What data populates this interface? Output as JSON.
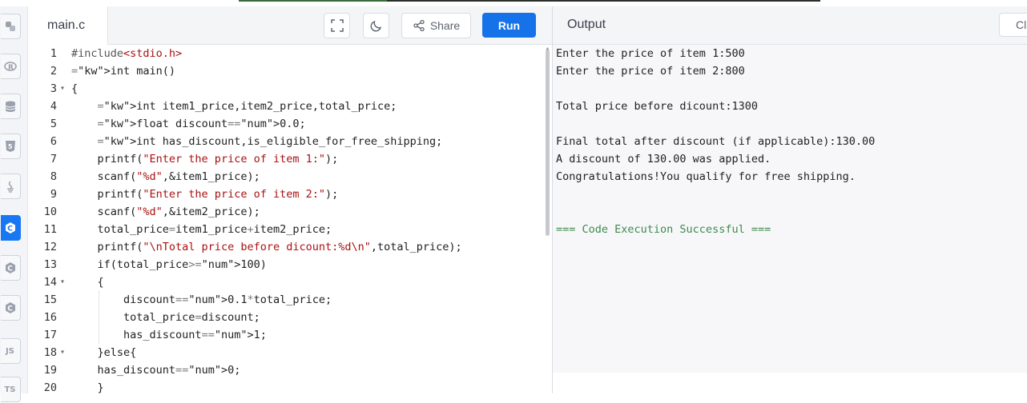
{
  "rail": {
    "items": [
      {
        "name": "python-icon",
        "active": false
      },
      {
        "name": "r-icon",
        "active": false
      },
      {
        "name": "sql-icon",
        "active": false
      },
      {
        "name": "html5-icon",
        "active": false
      },
      {
        "name": "java-icon",
        "active": false
      },
      {
        "name": "c-icon",
        "active": true
      },
      {
        "name": "cpp-icon",
        "active": false
      },
      {
        "name": "csharp-icon",
        "active": false
      },
      {
        "name": "js-icon",
        "label": "JS",
        "active": false
      },
      {
        "name": "ts-icon",
        "label": "TS",
        "active": false
      }
    ]
  },
  "editor": {
    "file_name": "main.c",
    "share_label": "Share",
    "run_label": "Run",
    "lines": [
      {
        "n": "1",
        "fold": "",
        "text": "#include<stdio.h>"
      },
      {
        "n": "2",
        "fold": "",
        "text": "int main()"
      },
      {
        "n": "3",
        "fold": "▾",
        "text": "{"
      },
      {
        "n": "4",
        "fold": "",
        "text": "    int item1_price,item2_price,total_price;"
      },
      {
        "n": "5",
        "fold": "",
        "text": "    float discount=0.0;"
      },
      {
        "n": "6",
        "fold": "",
        "text": "    int has_discount,is_eligible_for_free_shipping;"
      },
      {
        "n": "7",
        "fold": "",
        "text": "    printf(\"Enter the price of item 1:\");"
      },
      {
        "n": "8",
        "fold": "",
        "text": "    scanf(\"%d\",&item1_price);"
      },
      {
        "n": "9",
        "fold": "",
        "text": "    printf(\"Enter the price of item 2:\");"
      },
      {
        "n": "10",
        "fold": "",
        "text": "    scanf(\"%d\",&item2_price);"
      },
      {
        "n": "11",
        "fold": "",
        "text": "    total_price=item1_price+item2_price;"
      },
      {
        "n": "12",
        "fold": "",
        "text": "    printf(\"\\nTotal price before dicount:%d\\n\",total_price);"
      },
      {
        "n": "13",
        "fold": "",
        "text": "    if(total_price>100)"
      },
      {
        "n": "14",
        "fold": "▾",
        "text": "    {"
      },
      {
        "n": "15",
        "fold": "",
        "text": "        discount=0.1*total_price;"
      },
      {
        "n": "16",
        "fold": "",
        "text": "        total_price=discount;"
      },
      {
        "n": "17",
        "fold": "",
        "text": "        has_discount=1;"
      },
      {
        "n": "18",
        "fold": "▾",
        "text": "    }else{"
      },
      {
        "n": "19",
        "fold": "",
        "text": "    has_discount=0;"
      },
      {
        "n": "20",
        "fold": "",
        "text": "    }"
      }
    ]
  },
  "output": {
    "title": "Output",
    "clear_label": "Cl",
    "lines": [
      {
        "text": "Enter the price of item 1:500",
        "success": false
      },
      {
        "text": "Enter the price of item 2:800",
        "success": false
      },
      {
        "text": "",
        "success": false
      },
      {
        "text": "Total price before dicount:1300",
        "success": false
      },
      {
        "text": "",
        "success": false
      },
      {
        "text": "Final total after discount (if applicable):130.00",
        "success": false
      },
      {
        "text": "A discount of 130.00 was applied.",
        "success": false
      },
      {
        "text": "Congratulations!You qualify for free shipping.",
        "success": false
      },
      {
        "text": "",
        "success": false
      },
      {
        "text": "",
        "success": false
      },
      {
        "text": "=== Code Execution Successful ===",
        "success": true
      }
    ]
  },
  "colors": {
    "accent": "#1672e8",
    "success": "#3c8a4e",
    "keyword": "#1a1aa6",
    "string": "#aa1111"
  }
}
